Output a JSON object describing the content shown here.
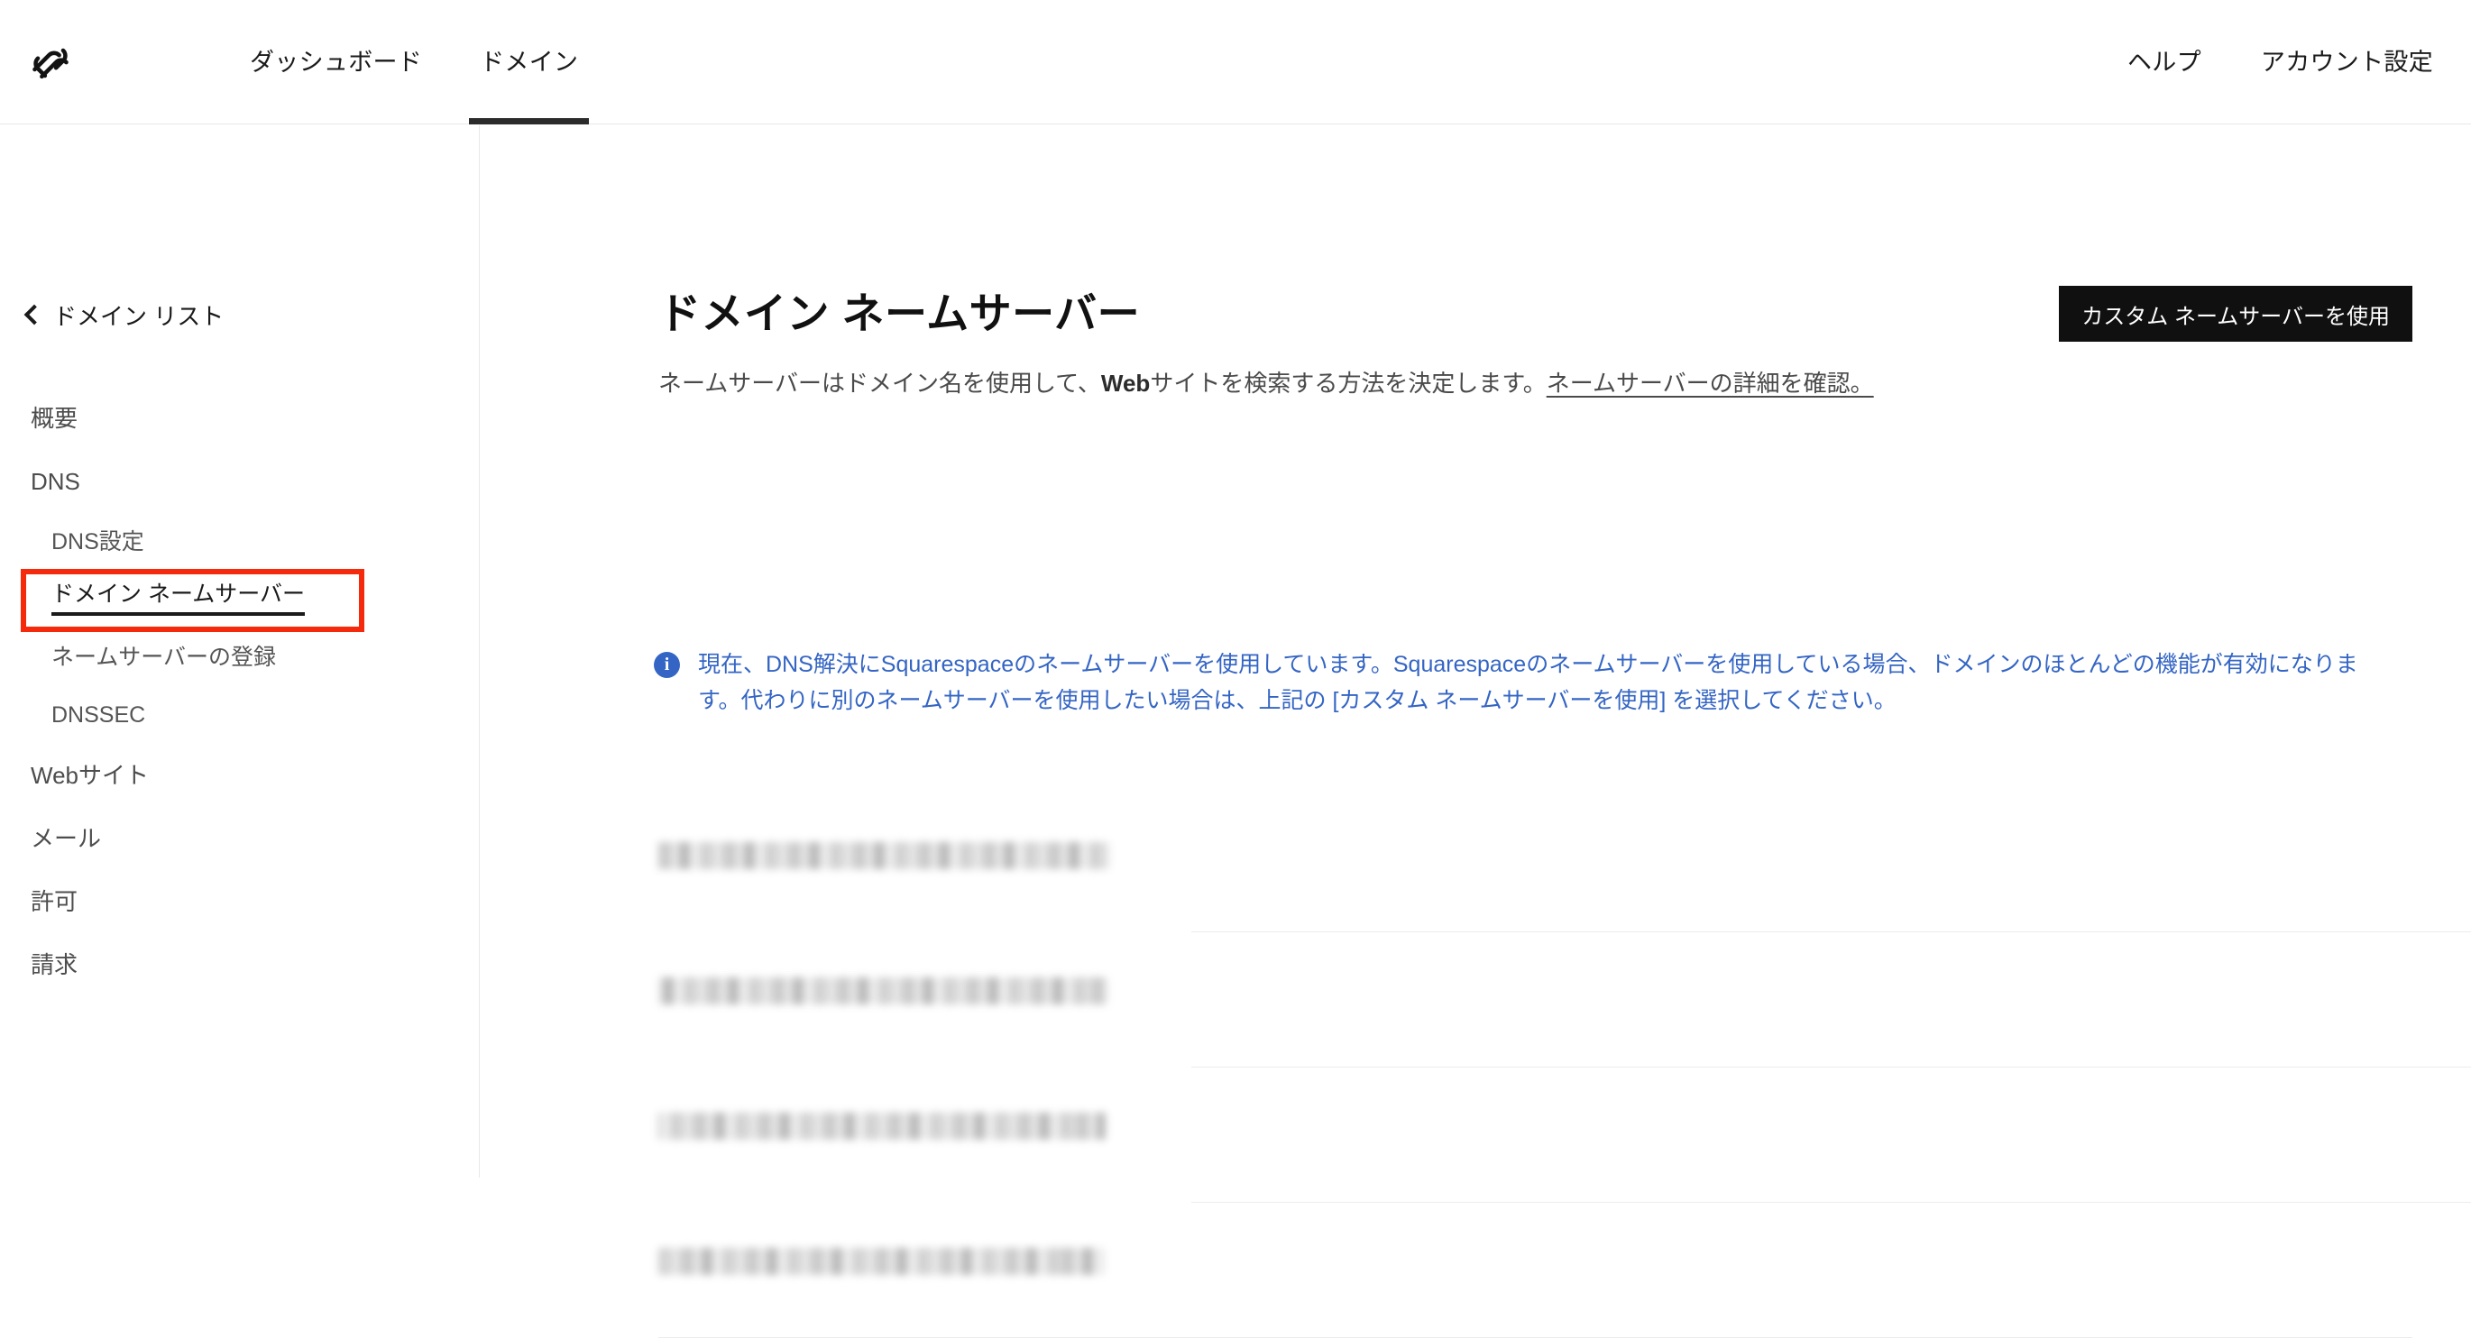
{
  "header": {
    "logo_icon": "squarespace-logo-icon",
    "nav_left": [
      {
        "label": "ダッシュボード",
        "active": false
      },
      {
        "label": "ドメイン",
        "active": true
      }
    ],
    "nav_right": [
      {
        "label": "ヘルプ"
      },
      {
        "label": "アカウント設定"
      }
    ]
  },
  "sidebar": {
    "back_label": "ドメイン リスト",
    "back_icon": "chevron-left-icon",
    "items": [
      {
        "label": "概要",
        "level": "top",
        "current": false
      },
      {
        "label": "DNS",
        "level": "top",
        "current": false
      },
      {
        "label": "DNS設定",
        "level": "sub",
        "current": false
      },
      {
        "label": "ドメイン ネームサーバー",
        "level": "sub",
        "current": true
      },
      {
        "label": "ネームサーバーの登録",
        "level": "sub",
        "current": false
      },
      {
        "label": "DNSSEC",
        "level": "sub",
        "current": false
      },
      {
        "label": "Webサイト",
        "level": "top",
        "current": false
      },
      {
        "label": "メール",
        "level": "top",
        "current": false
      },
      {
        "label": "許可",
        "level": "top",
        "current": false
      },
      {
        "label": "請求",
        "level": "top",
        "current": false
      }
    ],
    "annotation_color": "#f52a0c"
  },
  "main": {
    "title": "ドメイン ネームサーバー",
    "description_part1": "ネームサーバーはドメイン名を使用して、",
    "description_bold": "Web",
    "description_part2": "サイトを検索する方法を決定します。",
    "description_link": "ネームサーバーの詳細を確認。",
    "primary_button": "カスタム ネームサーバーを使用",
    "notice": {
      "icon": "info-circle-icon",
      "text": "現在、DNS解決にSquarespaceのネームサーバーを使用しています。Squarespaceのネームサーバーを使用している場合、ドメインのほとんどの機能が有効になります。代わりに別のネームサーバーを使用したい場合は、上記の [カスタム ネームサーバーを使用] を選択してください。",
      "color": "#3465c4"
    },
    "nameservers": [
      {
        "value": "",
        "redacted": true
      },
      {
        "value": "",
        "redacted": true
      },
      {
        "value": "",
        "redacted": true
      },
      {
        "value": "",
        "redacted": true
      }
    ]
  },
  "colors": {
    "accent_button": "#101010",
    "notice_blue": "#3465c4",
    "annotation_red": "#f52a0c",
    "divider": "#e8e8e8"
  }
}
